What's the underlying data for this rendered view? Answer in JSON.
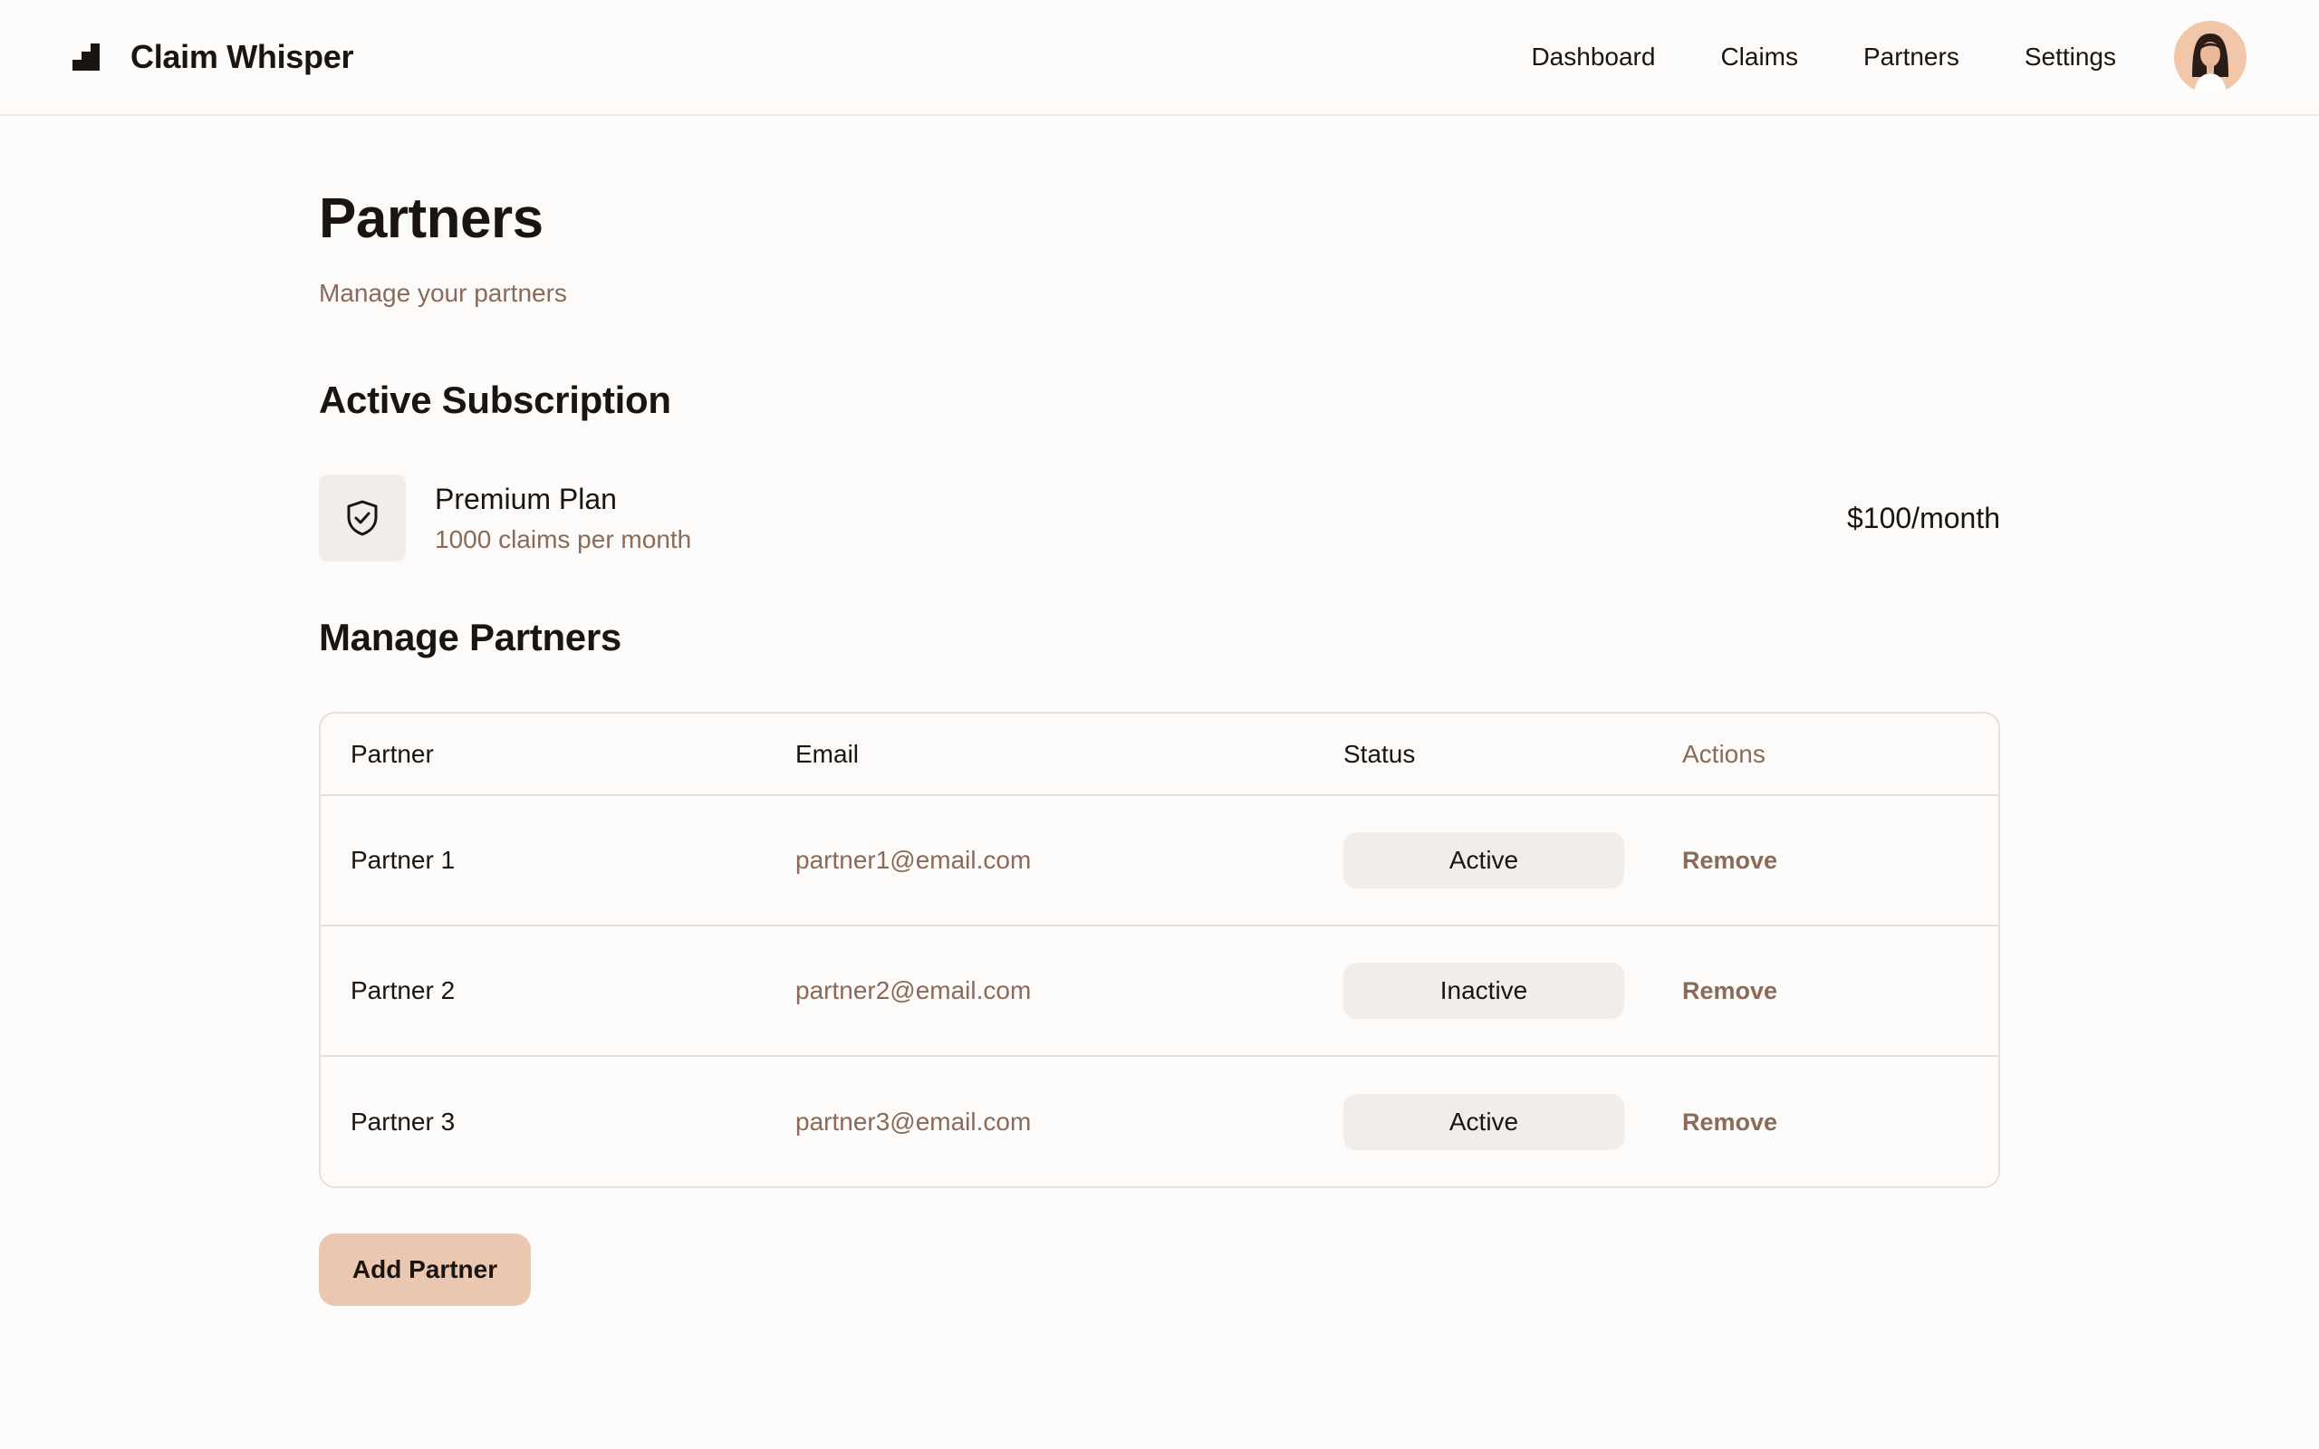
{
  "app": {
    "name": "Claim Whisper"
  },
  "nav": {
    "items": [
      "Dashboard",
      "Claims",
      "Partners",
      "Settings"
    ]
  },
  "page": {
    "title": "Partners",
    "subtitle": "Manage your partners"
  },
  "subscription": {
    "section_title": "Active Subscription",
    "plan_name": "Premium Plan",
    "plan_desc": "1000 claims per month",
    "price": "$100/month"
  },
  "partners": {
    "section_title": "Manage Partners",
    "columns": [
      "Partner",
      "Email",
      "Status",
      "Actions"
    ],
    "rows": [
      {
        "name": "Partner 1",
        "email": "partner1@email.com",
        "status": "Active",
        "action": "Remove"
      },
      {
        "name": "Partner 2",
        "email": "partner2@email.com",
        "status": "Inactive",
        "action": "Remove"
      },
      {
        "name": "Partner 3",
        "email": "partner3@email.com",
        "status": "Active",
        "action": "Remove"
      }
    ],
    "add_label": "Add Partner"
  },
  "colors": {
    "background": "#fcfbf9",
    "text": "#1c1410",
    "muted": "#8a6a58",
    "pill": "#f2ede9",
    "accent_button": "#e9c7b0"
  },
  "icons": {
    "logo": "stairs-logo-icon",
    "plan": "shield-check-icon",
    "avatar": "user-avatar"
  }
}
